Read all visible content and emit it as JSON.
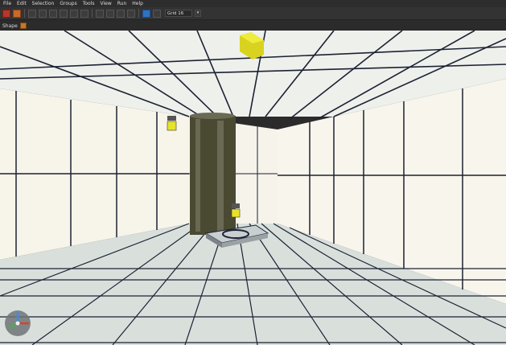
{
  "menu": {
    "items": [
      "File",
      "Edit",
      "Selection",
      "Groups",
      "Tools",
      "View",
      "Run",
      "Help"
    ]
  },
  "toolbar": {
    "grid_value": "Grid 16",
    "dropdown_arrow": "▾"
  },
  "toolrow": {
    "label": "Shape"
  },
  "viewport": {
    "floor_color": "#d9e0dc",
    "wall_color": "#f6f3ea",
    "grid_line_color": "#1c2233",
    "yellow_cube_color": "#e6e22a",
    "pillar_color": "#40402c"
  },
  "gizmo": {
    "axes": [
      "x-axis",
      "y-axis",
      "z-axis"
    ],
    "colors": {
      "x": "#d9422b",
      "y": "#3a8ee0",
      "z": "#4cae4c"
    }
  }
}
